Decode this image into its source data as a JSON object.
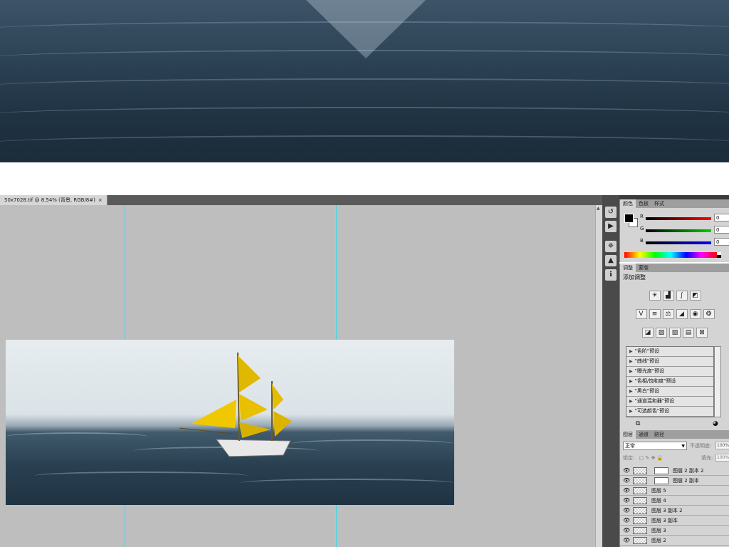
{
  "document": {
    "tab_title": "50x7028.tif @ 8.54% (背景, RGB/8#)",
    "tab_close": "×"
  },
  "panel_collapse": "«",
  "color_panel": {
    "tabs": [
      "颜色",
      "色板",
      "样式"
    ],
    "active_tab": 0,
    "channels": [
      {
        "label": "R",
        "value": "0",
        "color": "#d01010"
      },
      {
        "label": "G",
        "value": "0",
        "color": "#10b010"
      },
      {
        "label": "B",
        "value": "0",
        "color": "#1010c8"
      }
    ],
    "foreground": "#000000",
    "background": "#ffffff"
  },
  "adjustments_panel": {
    "tabs": [
      "调整",
      "蒙版"
    ],
    "active_tab": 0,
    "title": "添加调整",
    "icon_rows": [
      [
        "brightness-contrast-icon",
        "levels-icon",
        "curves-icon",
        "exposure-icon"
      ],
      [
        "vibrance-icon",
        "hue-saturation-icon",
        "color-balance-icon",
        "black-white-icon",
        "photo-filter-icon",
        "channel-mixer-icon"
      ],
      [
        "invert-icon",
        "posterize-icon",
        "threshold-icon",
        "gradient-map-icon",
        "selective-color-icon"
      ]
    ],
    "presets": [
      "\"色阶\"预设",
      "\"曲线\"预设",
      "\"曝光度\"预设",
      "\"色相/饱和度\"预设",
      "\"黑白\"预设",
      "\"通道混和器\"预设",
      "\"可选颜色\"预设"
    ]
  },
  "layers_panel": {
    "tabs": [
      "图层",
      "通道",
      "路径"
    ],
    "active_tab": 0,
    "blend_mode": "正常",
    "opacity_label": "不透明度:",
    "opacity_value": "100%",
    "lock_label": "锁定:",
    "fill_label": "填充:",
    "fill_value": "100%",
    "layers": [
      {
        "name": "图层 2 副本 2",
        "has_mask": true
      },
      {
        "name": "图层 2 副本",
        "has_mask": true
      },
      {
        "name": "图层 5",
        "has_mask": false
      },
      {
        "name": "图层 4",
        "has_mask": false
      },
      {
        "name": "图层 3 副本 2",
        "has_mask": false
      },
      {
        "name": "图层 3 副本",
        "has_mask": false
      },
      {
        "name": "图层 3",
        "has_mask": false
      },
      {
        "name": "图层 2",
        "has_mask": false
      }
    ]
  }
}
